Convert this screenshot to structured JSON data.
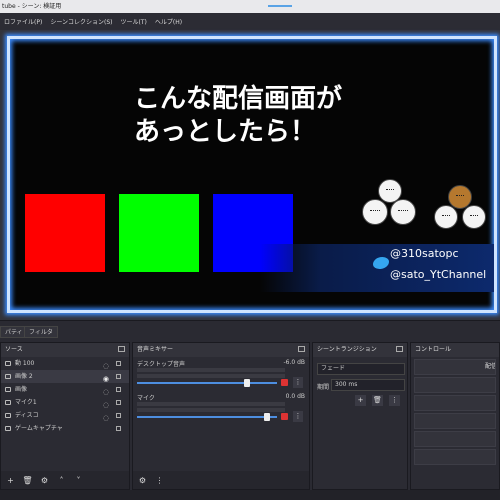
{
  "window": {
    "title": "tube - シーン: 検証用"
  },
  "menu": [
    "ロファイル(P)",
    "シーンコレクション(S)",
    "ツール(T)",
    "ヘルプ(H)"
  ],
  "preview": {
    "headline_line1": "こんな配信画面が",
    "headline_line2": "あっとしたら！",
    "squares": [
      "#ff0000",
      "#00ff00",
      "#0000ff"
    ],
    "twitter_handle": "@310satopc",
    "youtube_handle": "@sato_YtChannel",
    "frame_color": "#3b8cff"
  },
  "properties_bar": {
    "tab1": "パティ",
    "tab2": "フィルタ"
  },
  "sources": {
    "title": "ソース",
    "items": [
      {
        "label": "動 100",
        "selected": false
      },
      {
        "label": "画像 2",
        "selected": true
      },
      {
        "label": "画像",
        "selected": false
      },
      {
        "label": "マイク1",
        "selected": false
      },
      {
        "label": "ディスコ",
        "selected": false
      },
      {
        "label": "ゲームキャプチャ",
        "selected": false
      }
    ],
    "footer": {
      "add": "+",
      "remove": "🗑",
      "settings": "⚙",
      "up": "˄",
      "down": "˅"
    }
  },
  "mixer": {
    "title": "音声ミキサー",
    "channels": [
      {
        "name": "デスクトップ音声",
        "db": "-6.0 dB",
        "level": 0.8
      },
      {
        "name": "マイク",
        "db": "0.0 dB",
        "level": 0.95
      }
    ],
    "footer_gear": "⚙",
    "footer_menu": "⋮"
  },
  "transitions": {
    "title": "シーントランジション",
    "type": "フェード",
    "duration_label": "期間",
    "duration_value": "300 ms",
    "add": "+",
    "remove": "🗑",
    "menu": "⋮"
  },
  "controls": {
    "title": "コントロール",
    "buttons": [
      "配信"
    ]
  }
}
